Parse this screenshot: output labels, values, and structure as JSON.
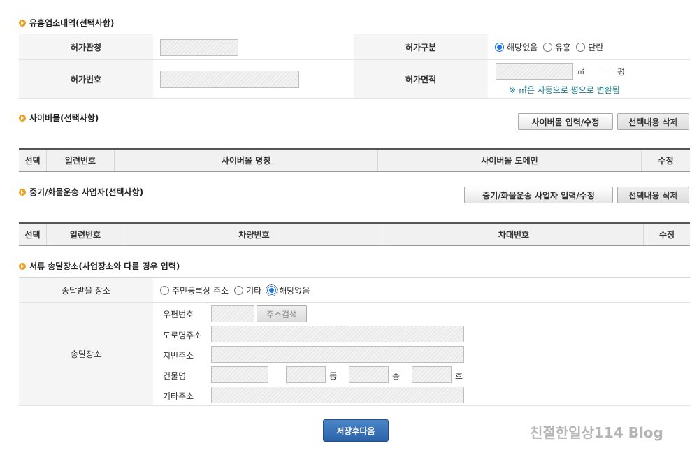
{
  "section1": {
    "title": "유흥업소내역(선택사항)",
    "permit_office_label": "허가관청",
    "permit_type_label": "허가구분",
    "permit_type_options": [
      "해당없음",
      "유흥",
      "단란"
    ],
    "permit_type_selected": "해당없음",
    "permit_no_label": "허가번호",
    "permit_area_label": "허가면적",
    "area_unit": "㎡",
    "pyeong_value": "---",
    "pyeong_unit": "평",
    "area_note": "※ ㎡은 자동으로 평으로 변환됨"
  },
  "section2": {
    "title": "사이버몰(선택사항)",
    "btn_input": "사이버몰 입력/수정",
    "btn_delete": "선택내용 삭제",
    "columns": [
      "선택",
      "일련번호",
      "사이버몰 명칭",
      "사이버몰 도메인",
      "수정"
    ]
  },
  "section3": {
    "title": "중기/화물운송 사업자(선택사항)",
    "btn_input": "중기/화물운송 사업자 입력/수정",
    "btn_delete": "선택내용 삭제",
    "columns": [
      "선택",
      "일련번호",
      "차량번호",
      "차대번호",
      "수정"
    ]
  },
  "section4": {
    "title": "서류 송달장소(사업장소와 다를 경우 입력)",
    "place_label": "송달받을 장소",
    "place_options": [
      "주민등록상 주소",
      "기타",
      "해당없음"
    ],
    "place_selected": "해당없음",
    "address_label": "송달장소",
    "postal_label": "우편번호",
    "search_btn": "주소검색",
    "road_label": "도로명주소",
    "lot_label": "지번주소",
    "building_label": "건물명",
    "dong": "동",
    "floor": "층",
    "ho": "호",
    "etc_label": "기타주소"
  },
  "footer": {
    "submit": "저장후다음",
    "watermark": "친절한일상114 Blog"
  }
}
